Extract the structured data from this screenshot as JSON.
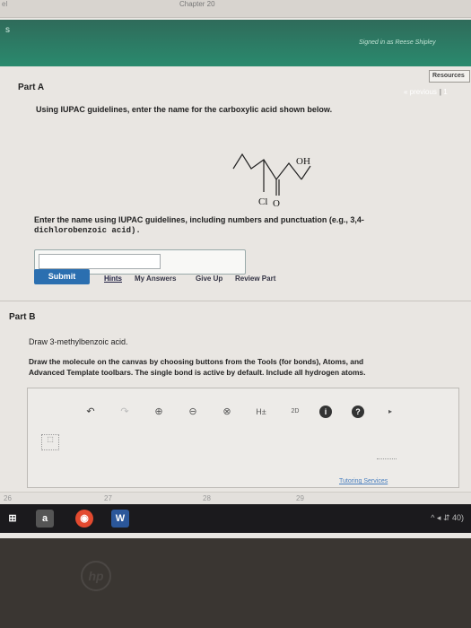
{
  "browser": {
    "tab_label": "Chapter 20",
    "corner_text": "el"
  },
  "header": {
    "left_letter": "s",
    "signin_text": "Signed in as Reese Shipley",
    "resources_label": "Resources"
  },
  "nav": {
    "previous_label": "« previous",
    "separator": "|",
    "page": "1"
  },
  "part_a": {
    "title": "Part A",
    "question": "Using IUPAC guidelines, enter the name for the carboxylic acid shown below.",
    "molecule": {
      "oh_label": "OH",
      "cl_label": "Cl",
      "o_label": "O"
    },
    "instruction": "Enter the name using IUPAC guidelines, including numbers and punctuation (e.g., 3,4-",
    "example_mono": "dichlorobenzoic acid).",
    "answer_value": "",
    "submit_label": "Submit",
    "links": {
      "hints": "Hints",
      "my_answers": "My Answers",
      "give_up": "Give Up",
      "review_part": "Review Part"
    }
  },
  "part_b": {
    "title": "Part B",
    "question": "Draw 3-methylbenzoic acid.",
    "instruction_1": "Draw the molecule on the canvas by choosing buttons from the Tools (for bonds), Atoms, and",
    "instruction_2": "Advanced Template toolbars. The single bond is active by default. Include all hydrogen atoms.",
    "toolbar": {
      "undo": "↶",
      "redo": "↷",
      "zoom_in": "⊕",
      "zoom_out": "⊖",
      "reset": "⊗",
      "h_toggle": "H±",
      "two_d": "2D",
      "info": "i",
      "help": "?",
      "expand": "▸"
    },
    "tutoring_label": "Tutoring Services"
  },
  "ruler": {
    "labels": [
      "26",
      "27",
      "28",
      "29"
    ]
  },
  "taskbar": {
    "start": "⊞",
    "amazon": "a",
    "chrome": "◉",
    "word": "W",
    "tray": "^ ◂ ⇵ 40)"
  },
  "colors": {
    "ribbon": "#2a8a6e",
    "submit": "#2b6fb0",
    "taskbar": "#1b1a1d"
  },
  "bezel_logo": "hp"
}
